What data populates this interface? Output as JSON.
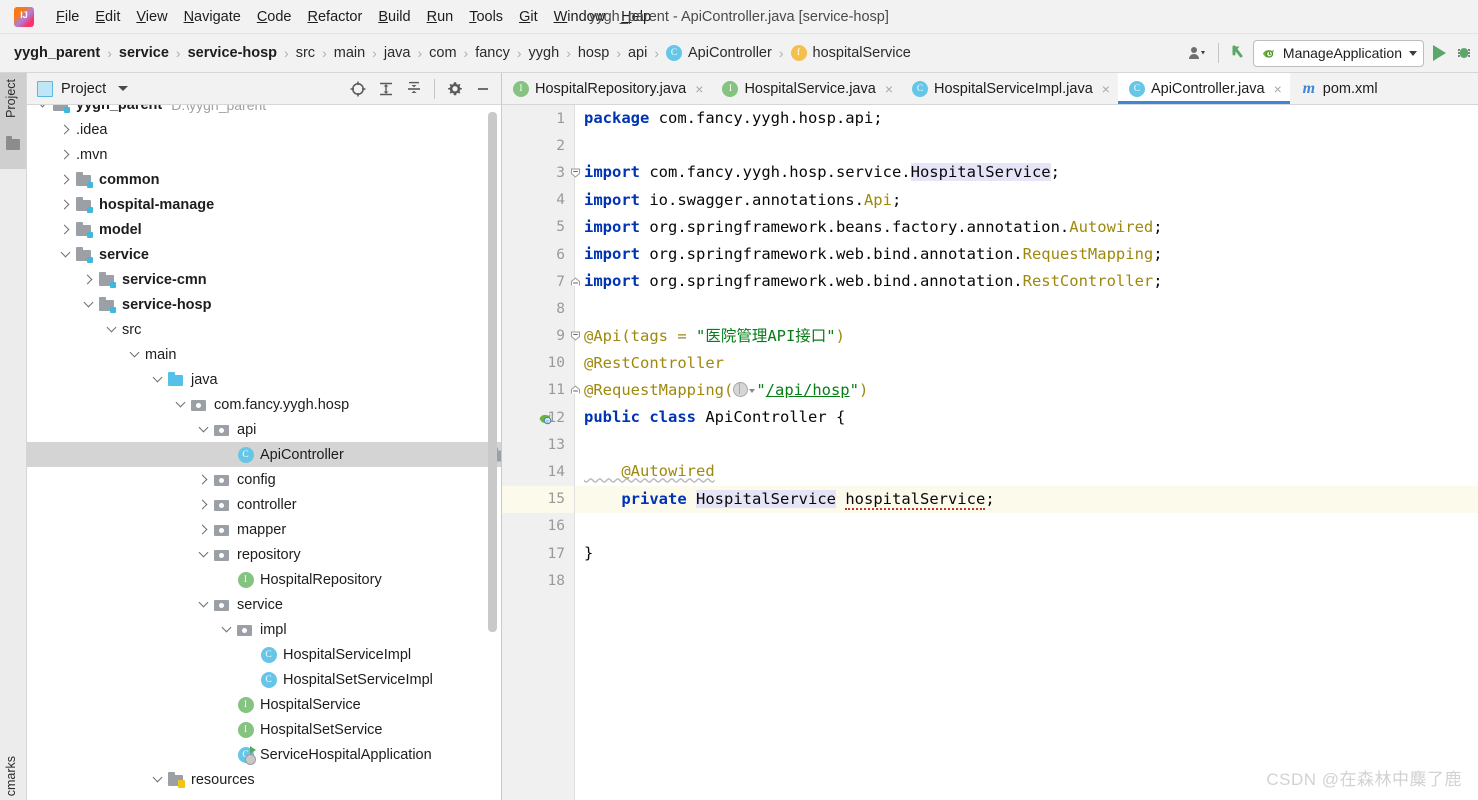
{
  "window": {
    "title": "yygh_parent - ApiController.java [service-hosp]",
    "app_logo": "intellij-idea-logo"
  },
  "menubar": {
    "items": [
      {
        "label": "File",
        "mnemonic": "F"
      },
      {
        "label": "Edit",
        "mnemonic": "E"
      },
      {
        "label": "View",
        "mnemonic": "V"
      },
      {
        "label": "Navigate",
        "mnemonic": "N"
      },
      {
        "label": "Code",
        "mnemonic": "C"
      },
      {
        "label": "Refactor",
        "mnemonic": "R"
      },
      {
        "label": "Build",
        "mnemonic": "B"
      },
      {
        "label": "Run",
        "mnemonic": "R"
      },
      {
        "label": "Tools",
        "mnemonic": "T"
      },
      {
        "label": "Git",
        "mnemonic": "G"
      },
      {
        "label": "Window",
        "mnemonic": "W"
      },
      {
        "label": "Help",
        "mnemonic": "H"
      }
    ]
  },
  "breadcrumb": {
    "separator": "›",
    "items": [
      {
        "label": "yygh_parent",
        "bold": true,
        "icon": null
      },
      {
        "label": "service",
        "bold": true,
        "icon": null
      },
      {
        "label": "service-hosp",
        "bold": true,
        "icon": null
      },
      {
        "label": "src",
        "bold": false,
        "icon": null
      },
      {
        "label": "main",
        "bold": false,
        "icon": null
      },
      {
        "label": "java",
        "bold": false,
        "icon": null
      },
      {
        "label": "com",
        "bold": false,
        "icon": null
      },
      {
        "label": "fancy",
        "bold": false,
        "icon": null
      },
      {
        "label": "yygh",
        "bold": false,
        "icon": null
      },
      {
        "label": "hosp",
        "bold": false,
        "icon": null
      },
      {
        "label": "api",
        "bold": false,
        "icon": null
      },
      {
        "label": "ApiController",
        "bold": false,
        "icon": "class-badge"
      },
      {
        "label": "hospitalService",
        "bold": false,
        "icon": "field-badge"
      }
    ]
  },
  "toolbar": {
    "account_icon": "user-icon",
    "vcs_updown_icon": "vcs-arrow-icon",
    "run_config": "ManageApplication",
    "run_config_icon": "spring-boot-icon",
    "run_icon": "run-play-icon",
    "debug_icon": "debug-icon"
  },
  "project_panel": {
    "title": "Project",
    "view_icon": "project-view-icon",
    "tools": [
      {
        "name": "locate-icon",
        "glyph": "target"
      },
      {
        "name": "expand-all-icon",
        "glyph": "expand"
      },
      {
        "name": "collapse-all-icon",
        "glyph": "collapse"
      },
      {
        "name": "settings-gear-icon",
        "glyph": "gear"
      },
      {
        "name": "hide-panel-icon",
        "glyph": "minus"
      }
    ],
    "tree": [
      {
        "label": "yygh_parent",
        "suffix": "D:\\yygh_parent",
        "indent": 0,
        "arrow": "down",
        "icon": "module",
        "bold": true,
        "selected": false,
        "clipped": true
      },
      {
        "label": ".idea",
        "suffix": "",
        "indent": 1,
        "arrow": "right",
        "icon": "folder",
        "bold": false,
        "selected": false
      },
      {
        "label": ".mvn",
        "suffix": "",
        "indent": 1,
        "arrow": "right",
        "icon": "folder",
        "bold": false,
        "selected": false
      },
      {
        "label": "common",
        "suffix": "",
        "indent": 1,
        "arrow": "right",
        "icon": "module",
        "bold": true,
        "selected": false
      },
      {
        "label": "hospital-manage",
        "suffix": "",
        "indent": 1,
        "arrow": "right",
        "icon": "module",
        "bold": true,
        "selected": false
      },
      {
        "label": "model",
        "suffix": "",
        "indent": 1,
        "arrow": "right",
        "icon": "module",
        "bold": true,
        "selected": false
      },
      {
        "label": "service",
        "suffix": "",
        "indent": 1,
        "arrow": "down",
        "icon": "module",
        "bold": true,
        "selected": false
      },
      {
        "label": "service-cmn",
        "suffix": "",
        "indent": 2,
        "arrow": "right",
        "icon": "module",
        "bold": true,
        "selected": false
      },
      {
        "label": "service-hosp",
        "suffix": "",
        "indent": 2,
        "arrow": "down",
        "icon": "module",
        "bold": true,
        "selected": false
      },
      {
        "label": "src",
        "suffix": "",
        "indent": 3,
        "arrow": "down",
        "icon": "folder",
        "bold": false,
        "selected": false
      },
      {
        "label": "main",
        "suffix": "",
        "indent": 4,
        "arrow": "down",
        "icon": "folder",
        "bold": false,
        "selected": false
      },
      {
        "label": "java",
        "suffix": "",
        "indent": 5,
        "arrow": "down",
        "icon": "source-folder",
        "bold": false,
        "selected": false
      },
      {
        "label": "com.fancy.yygh.hosp",
        "suffix": "",
        "indent": 6,
        "arrow": "down",
        "icon": "package",
        "bold": false,
        "selected": false
      },
      {
        "label": "api",
        "suffix": "",
        "indent": 7,
        "arrow": "down",
        "icon": "package",
        "bold": false,
        "selected": false
      },
      {
        "label": "ApiController",
        "suffix": "",
        "indent": 8,
        "arrow": "none",
        "icon": "class",
        "bold": false,
        "selected": true
      },
      {
        "label": "config",
        "suffix": "",
        "indent": 7,
        "arrow": "right",
        "icon": "package",
        "bold": false,
        "selected": false
      },
      {
        "label": "controller",
        "suffix": "",
        "indent": 7,
        "arrow": "right",
        "icon": "package",
        "bold": false,
        "selected": false
      },
      {
        "label": "mapper",
        "suffix": "",
        "indent": 7,
        "arrow": "right",
        "icon": "package",
        "bold": false,
        "selected": false
      },
      {
        "label": "repository",
        "suffix": "",
        "indent": 7,
        "arrow": "down",
        "icon": "package",
        "bold": false,
        "selected": false
      },
      {
        "label": "HospitalRepository",
        "suffix": "",
        "indent": 8,
        "arrow": "none",
        "icon": "interface",
        "bold": false,
        "selected": false
      },
      {
        "label": "service",
        "suffix": "",
        "indent": 7,
        "arrow": "down",
        "icon": "package",
        "bold": false,
        "selected": false
      },
      {
        "label": "impl",
        "suffix": "",
        "indent": 8,
        "arrow": "down",
        "icon": "package",
        "bold": false,
        "selected": false
      },
      {
        "label": "HospitalServiceImpl",
        "suffix": "",
        "indent": 9,
        "arrow": "none",
        "icon": "class",
        "bold": false,
        "selected": false
      },
      {
        "label": "HospitalSetServiceImpl",
        "suffix": "",
        "indent": 9,
        "arrow": "none",
        "icon": "class",
        "bold": false,
        "selected": false
      },
      {
        "label": "HospitalService",
        "suffix": "",
        "indent": 8,
        "arrow": "none",
        "icon": "interface",
        "bold": false,
        "selected": false
      },
      {
        "label": "HospitalSetService",
        "suffix": "",
        "indent": 8,
        "arrow": "none",
        "icon": "interface",
        "bold": false,
        "selected": false
      },
      {
        "label": "ServiceHospitalApplication",
        "suffix": "",
        "indent": 8,
        "arrow": "none",
        "icon": "spring-app-class",
        "bold": false,
        "selected": false
      },
      {
        "label": "resources",
        "suffix": "",
        "indent": 5,
        "arrow": "down",
        "icon": "resources-folder",
        "bold": false,
        "selected": false
      }
    ]
  },
  "rail": {
    "project_label": "Project",
    "bookmarks_label": "cmarks",
    "folder_icon": "folder-icon"
  },
  "editor": {
    "tabs": [
      {
        "label": "HospitalRepository.java",
        "icon": "interface",
        "active": false,
        "close": "×"
      },
      {
        "label": "HospitalService.java",
        "icon": "interface",
        "active": false,
        "close": "×"
      },
      {
        "label": "HospitalServiceImpl.java",
        "icon": "class",
        "active": false,
        "close": "×"
      },
      {
        "label": "ApiController.java",
        "icon": "class",
        "active": true,
        "close": "×"
      },
      {
        "label": "pom.xml",
        "icon": "maven-xml",
        "active": false,
        "close": ""
      }
    ],
    "caret_line": 15,
    "gutter": {
      "line_numbers": [
        1,
        2,
        3,
        4,
        5,
        6,
        7,
        8,
        9,
        10,
        11,
        12,
        13,
        14,
        15,
        16,
        17,
        18
      ],
      "fold_open_lines": [
        3,
        9
      ],
      "fold_close_lines": [
        7,
        11
      ],
      "run_marker_line": 12,
      "run_marker_icon": "spring-bean-gutter-icon"
    },
    "code_lines": [
      {
        "n": 1,
        "text": "package com.fancy.yygh.hosp.api;"
      },
      {
        "n": 2,
        "text": ""
      },
      {
        "n": 3,
        "text": "import com.fancy.yygh.hosp.service.HospitalService;"
      },
      {
        "n": 4,
        "text": "import io.swagger.annotations.Api;"
      },
      {
        "n": 5,
        "text": "import org.springframework.beans.factory.annotation.Autowired;"
      },
      {
        "n": 6,
        "text": "import org.springframework.web.bind.annotation.RequestMapping;"
      },
      {
        "n": 7,
        "text": "import org.springframework.web.bind.annotation.RestController;"
      },
      {
        "n": 8,
        "text": ""
      },
      {
        "n": 9,
        "text": "@Api(tags = \"医院管理API接口\")"
      },
      {
        "n": 10,
        "text": "@RestController"
      },
      {
        "n": 11,
        "text": "@RequestMapping(\"/api/hosp\")"
      },
      {
        "n": 12,
        "text": "public class ApiController {"
      },
      {
        "n": 13,
        "text": ""
      },
      {
        "n": 14,
        "text": "    @Autowired"
      },
      {
        "n": 15,
        "text": "    private HospitalService hospitalService;"
      },
      {
        "n": 16,
        "text": ""
      },
      {
        "n": 17,
        "text": "}"
      },
      {
        "n": 18,
        "text": ""
      }
    ],
    "tokens": {
      "package_kw": "package",
      "import_kw": "import",
      "public_kw": "public",
      "class_kw": "class",
      "private_kw": "private",
      "pkg_name": " com.fancy.yygh.hosp.api;",
      "imp3_prefix": " com.fancy.yygh.hosp.service.",
      "imp3_type": "HospitalService",
      "imp4_prefix": " io.swagger.annotations.",
      "imp4_type": "Api",
      "imp5_prefix": " org.springframework.beans.factory.annotation.",
      "imp5_type": "Autowired",
      "imp6_prefix": " org.springframework.web.bind.annotation.",
      "imp6_type": "RequestMapping",
      "imp7_prefix": " org.springframework.web.bind.annotation.",
      "imp7_type": "RestController",
      "semi": ";",
      "api_ann": "@Api(tags = ",
      "api_str": "\"医院管理API接口\"",
      "api_close": ")",
      "restcontroller_ann": "@RestController",
      "reqmap_ann": "@RequestMapping(",
      "reqmap_quote_open": "\"",
      "reqmap_url": "/api/hosp",
      "reqmap_quote_close": "\"",
      "reqmap_close": ")",
      "class_name": " ApiController ",
      "brace_open": "{",
      "autowired_ann": "@Autowired",
      "field_type": "HospitalService",
      "field_name": "hospitalService",
      "brace_close": "}"
    },
    "colors": {
      "keyword": "#0033b3",
      "annotation": "#9e880d",
      "string": "#067d17",
      "identifier": "#080808",
      "caret_line_bg": "#fcfaeb",
      "symbol_highlight": "#e6e4f7",
      "active_tab_underline": "#3e86d6"
    }
  },
  "watermark": "CSDN @在森林中麋了鹿"
}
